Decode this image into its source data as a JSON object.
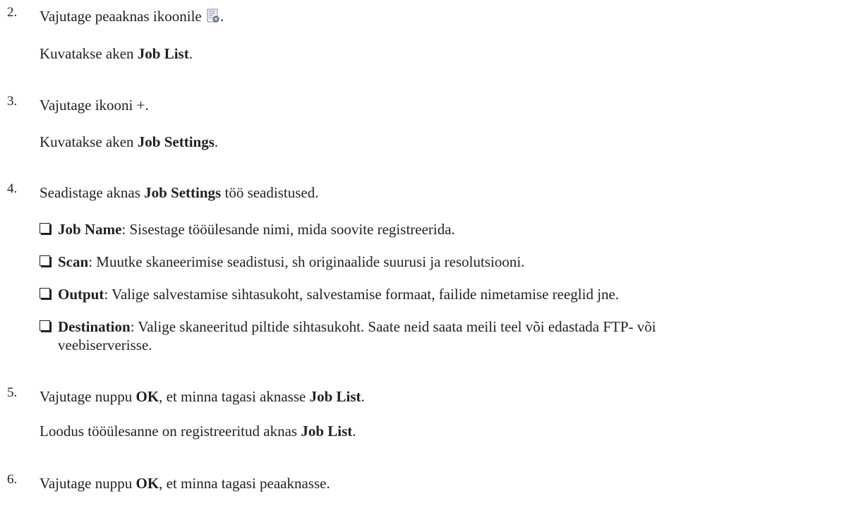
{
  "steps": [
    {
      "number": "2.",
      "line_before_icon": "Vajutage peaaknas ikoonile",
      "line_after_icon": ".",
      "icon": "job-list-settings-icon",
      "result_prefix": "Kuvatakse aken ",
      "result_bold": "Job List",
      "result_suffix": "."
    },
    {
      "number": "3.",
      "line": "Vajutage ikooni +.",
      "result_prefix": "Kuvatakse aken ",
      "result_bold": "Job Settings",
      "result_suffix": "."
    },
    {
      "number": "4.",
      "line_prefix": "Seadistage aknas ",
      "line_bold": "Job Settings",
      "line_suffix": " töö seadistused.",
      "bullets": [
        {
          "label": "Job Name",
          "text": ": Sisestage tööülesande nimi, mida soovite registreerida."
        },
        {
          "label": "Scan",
          "text": ": Muutke skaneerimise seadistusi, sh originaalide suurusi ja resolutsiooni."
        },
        {
          "label": "Output",
          "text": ": Valige salvestamise sihtasukoht, salvestamise formaat, failide nimetamise reeglid jne."
        },
        {
          "label": "Destination",
          "text": ": Valige skaneeritud piltide sihtasukoht. Saate neid saata meili teel või edastada FTP- või",
          "text2": "veebiserverisse."
        }
      ]
    },
    {
      "number": "5.",
      "line_prefix": "Vajutage nuppu ",
      "line_bold1": "OK",
      "line_mid": ", et minna tagasi aknasse ",
      "line_bold2": "Job List",
      "line_suffix": ".",
      "result_prefix": "Loodus tööülesanne on registreeritud aknas ",
      "result_bold": "Job List",
      "result_suffix": "."
    },
    {
      "number": "6.",
      "line_prefix": "Vajutage nuppu ",
      "line_bold": "OK",
      "line_suffix": ", et minna tagasi peaaknasse."
    }
  ]
}
